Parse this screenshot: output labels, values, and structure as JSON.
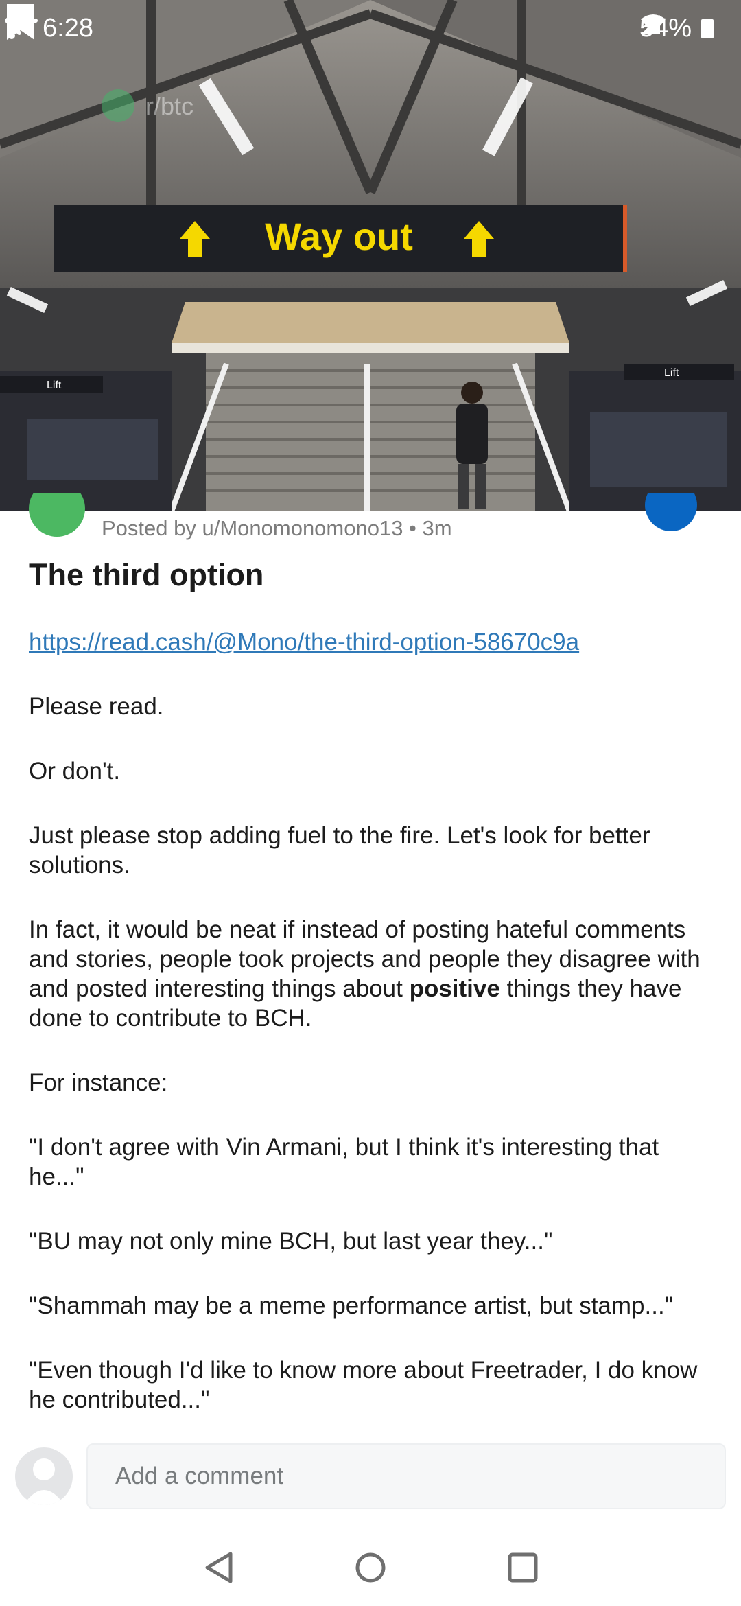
{
  "status_bar": {
    "time": "6:28",
    "battery": "54%"
  },
  "header": {
    "subreddit_name": "r/btc",
    "sign_text": "Way out",
    "left_sign_text": "Lift",
    "right_sign_text": "Lift",
    "icons": {
      "back": "arrow-left-icon",
      "bookmark": "bookmark-icon",
      "more": "more-vertical-icon"
    }
  },
  "post": {
    "posted_by": "Posted by u/Monomonomono13 • 3m",
    "title": "The third option",
    "link": "https://read.cash/@Mono/the-third-option-58670c9a",
    "paragraphs": {
      "p1": "Please read.",
      "p2": "Or don't.",
      "p3": "Just please stop adding fuel to the fire. Let's look for better solutions.",
      "p4_before": "In fact, it would be neat if instead of posting hateful comments and stories, people took projects and people they disagree with and posted interesting things about ",
      "p4_bold": "positive",
      "p4_after": " things they have done to contribute to BCH.",
      "p5": "For instance:",
      "p6": "\"I don't agree with Vin Armani, but I think it's interesting that he...\"",
      "p7": "\"BU may not only mine BCH, but last year they...\"",
      "p8": "\"Shammah may be a meme performance artist, but stamp...\"",
      "p9": "\"Even though I'd like to know more about Freetrader, I do know he contributed...\""
    }
  },
  "comment_bar": {
    "placeholder": "Add a comment"
  },
  "colors": {
    "link": "#2f79b8",
    "subreddit_icon": "#4cb862",
    "join_button": "#0a66c2",
    "sign_text": "#f5d800"
  }
}
